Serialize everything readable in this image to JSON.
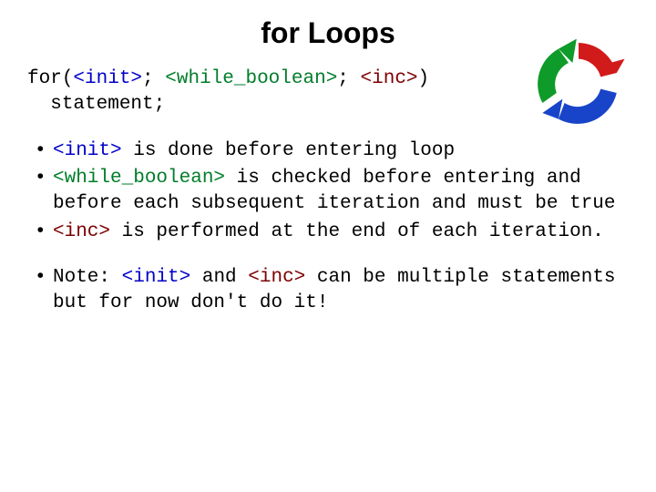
{
  "title": "for Loops",
  "code": {
    "kw_for": "for",
    "p_open": "(",
    "init": "<init>",
    "sep1": "; ",
    "while": "<while_boolean>",
    "sep2": "; ",
    "inc": "<inc>",
    "p_close": ")",
    "line2_indent": "  ",
    "stmt": "statement;"
  },
  "bullets": {
    "b1": {
      "init": "<init>",
      "rest": " is done before entering loop"
    },
    "b2": {
      "while": "<while_boolean>",
      "rest": " is checked before entering and before each subsequent iteration and must be true"
    },
    "b3": {
      "inc": "<inc>",
      "mid": " is performed at the end of each iteration."
    },
    "b4": {
      "pre": "Note: ",
      "init": "<init>",
      "and": " and ",
      "inc": "<inc>",
      "rest": " can be multiple statements but for now don't do it!"
    }
  },
  "icon": {
    "name": "cycle-arrows-icon"
  }
}
